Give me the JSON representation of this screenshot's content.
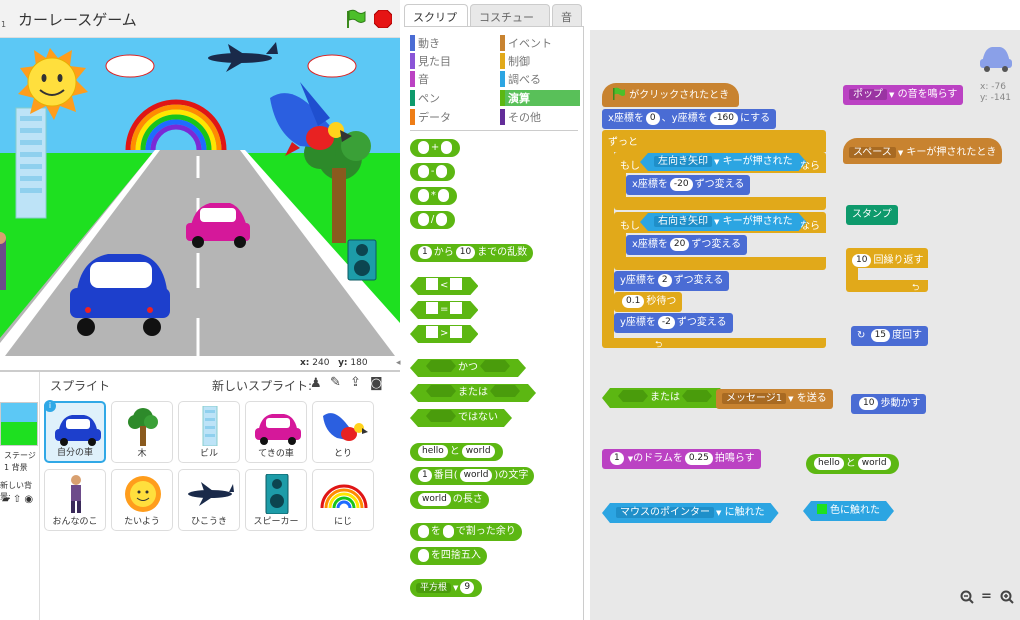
{
  "project": {
    "title": "カーレースゲーム"
  },
  "stage": {
    "x_label": "x:",
    "x_value": "240",
    "y_label": "y:",
    "y_value": "180"
  },
  "sprites_panel": {
    "title": "スプライト",
    "new_sprite_label": "新しいスプライト:",
    "stage_label": "ステージ",
    "stage_sub": "1 背景",
    "new_backdrop": "新しい背景:",
    "sprites": [
      {
        "name": "自分の車",
        "icon": "blue-car",
        "selected": true
      },
      {
        "name": "木",
        "icon": "tree"
      },
      {
        "name": "ビル",
        "icon": "building"
      },
      {
        "name": "てきの車",
        "icon": "pink-car"
      },
      {
        "name": "とり",
        "icon": "parrot"
      },
      {
        "name": "おんなのこ",
        "icon": "girl"
      },
      {
        "name": "たいよう",
        "icon": "sun"
      },
      {
        "name": "ひこうき",
        "icon": "airplane"
      },
      {
        "name": "スピーカー",
        "icon": "speaker"
      },
      {
        "name": "にじ",
        "icon": "rainbow"
      }
    ]
  },
  "tabs": [
    "スクリプト",
    "コスチューム",
    "音"
  ],
  "categories": [
    {
      "label": "動き",
      "color": "#4a6cd4"
    },
    {
      "label": "イベント",
      "color": "#c88330"
    },
    {
      "label": "見た目",
      "color": "#8a55d7"
    },
    {
      "label": "制御",
      "color": "#e1a91a"
    },
    {
      "label": "音",
      "color": "#bb42c3"
    },
    {
      "label": "調べる",
      "color": "#2ca5e2"
    },
    {
      "label": "ペン",
      "color": "#0e9a6c"
    },
    {
      "label": "演算",
      "color": "#5cb712"
    },
    {
      "label": "データ",
      "color": "#ee7d16"
    },
    {
      "label": "その他",
      "color": "#632d99"
    }
  ],
  "palette_blocks": {
    "plus": "+",
    "minus": "-",
    "times": "*",
    "divide": "/",
    "random_a": "1",
    "random_mid": "から",
    "random_b": "10",
    "random_end": "までの乱数",
    "lt": "<",
    "eq": "=",
    "gt": ">",
    "and": "かつ",
    "or": "または",
    "not": "ではない",
    "join_a": "hello",
    "join_mid": "と",
    "join_b": "world",
    "letter_n": "1",
    "letter_mid": "番目(",
    "letter_w": "world",
    "letter_end": ")の文字",
    "length_w": "world",
    "length_end": "の長さ",
    "mod_mid": "を",
    "mod_end": "で割った余り",
    "round_end": "を四捨五入",
    "sqrt_fn": "平方根",
    "sqrt_val": "9"
  },
  "script": {
    "hat_flag": "がクリックされたとき",
    "goto_x_label": "x座標を",
    "goto_x": "0",
    "goto_y_label": "、y座標を",
    "goto_y": "-160",
    "goto_end": "にする",
    "forever": "ずっと",
    "if1": "もし",
    "key1": "左向き矢印",
    "key_pressed": "キーが押された",
    "then": "なら",
    "change_x_label": "x座標を",
    "change_x1": "-20",
    "change_end": "ずつ変える",
    "if2": "もし",
    "key2": "右向き矢印",
    "change_x2": "20",
    "change_y_label": "y座標を",
    "change_y1": "2",
    "wait_val": "0.1",
    "wait_end": "秒待つ",
    "change_y2": "-2"
  },
  "loose_blocks": {
    "or_block": "または",
    "broadcast_msg": "メッセージ1",
    "broadcast_end": "を送る",
    "drum_n": "1",
    "drum_mid": "のドラムを",
    "drum_beats": "0.25",
    "drum_end": "拍鳴らす",
    "touching_obj": "マウスのポインター",
    "touching_end": "に触れた",
    "play_sound": "ポップ",
    "play_sound_end": "の音を鳴らす",
    "key_hat_key": "スペース",
    "key_hat_end": "キーが押されたとき",
    "stamp": "スタンプ",
    "repeat_n": "10",
    "repeat_end": "回繰り返す",
    "turn_n": "15",
    "turn_end": "度回す",
    "move_n": "10",
    "move_end": "歩動かす",
    "join_a": "hello",
    "join_mid": "と",
    "join_b": "world",
    "touch_color_end": "色に触れた"
  },
  "sprite_info": {
    "x_label": "x:",
    "x": "-76",
    "y_label": "y:",
    "y": "-141"
  },
  "zoom": {
    "out": "−",
    "reset": "=",
    "in": "+"
  }
}
